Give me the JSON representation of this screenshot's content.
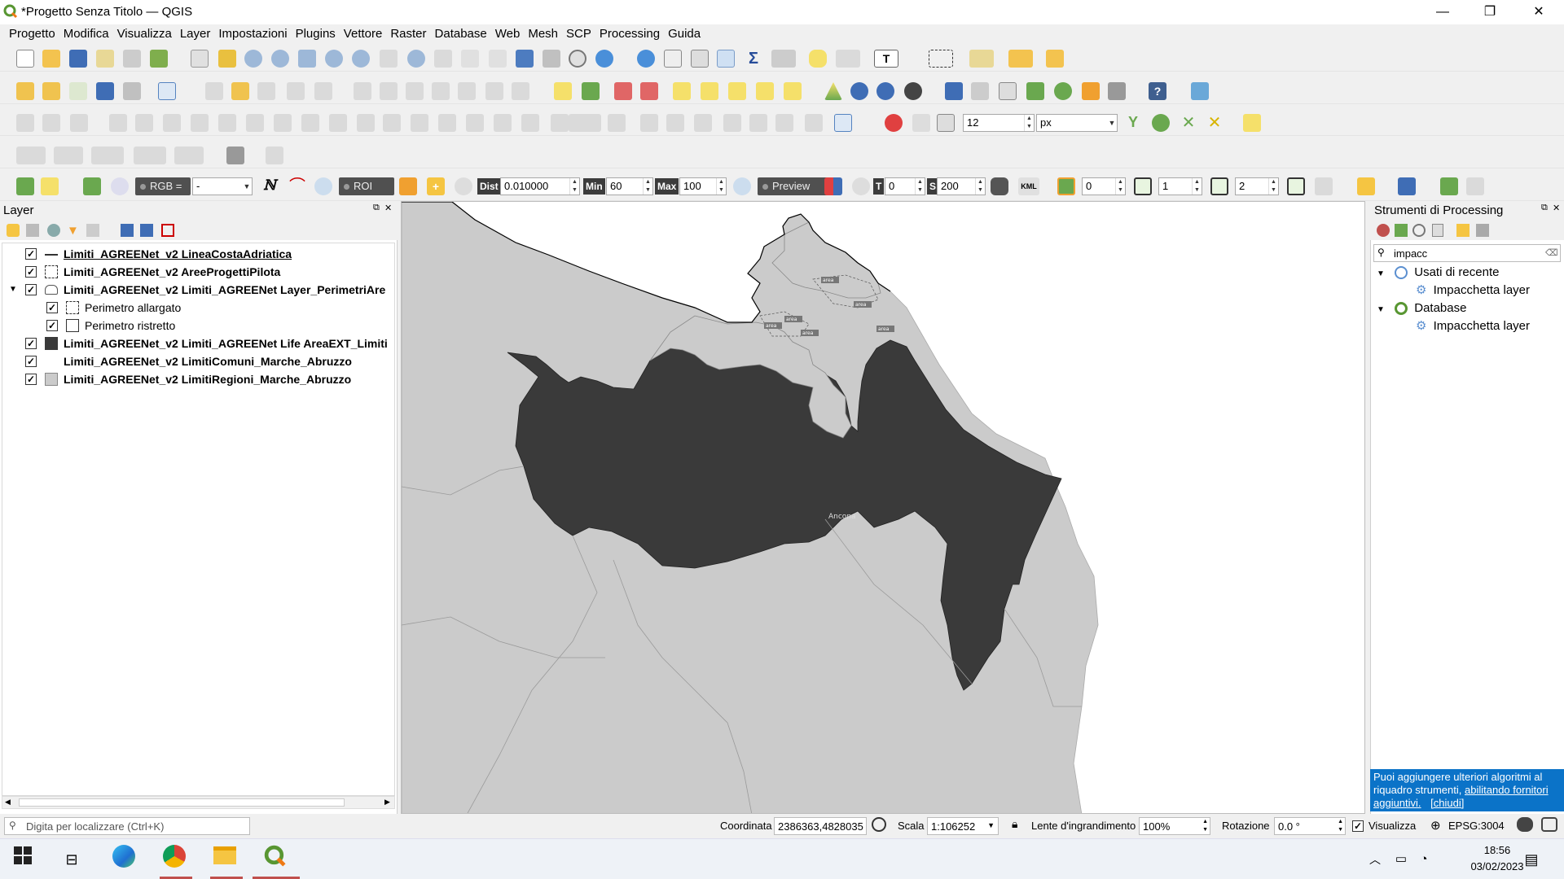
{
  "window": {
    "title": "*Progetto Senza Titolo — QGIS",
    "minimize": "—",
    "maximize": "❐",
    "close": "✕"
  },
  "menu": [
    "Progetto",
    "Modifica",
    "Visualizza",
    "Layer",
    "Impostazioni",
    "Plugins",
    "Vettore",
    "Raster",
    "Database",
    "Web",
    "Mesh",
    "SCP",
    "Processing",
    "Guida"
  ],
  "toolbar": {
    "snap_tolerance": "12",
    "snap_unit": "px",
    "rgb_label": "RGB =",
    "rgb_value": "-",
    "roi_label": "ROI",
    "dist_label": "Dist",
    "dist_value": "0.010000",
    "min_label": "Min",
    "min_value": "60",
    "max_label": "Max",
    "max_value": "100",
    "preview_label": "Preview",
    "t_label": "T",
    "t_value": "0",
    "s_label": "S",
    "s_value": "200",
    "kml_label": "KML",
    "band_value_1": "0",
    "band_value_2": "1",
    "band_value_3": "2"
  },
  "layers_panel": {
    "title": "Layer",
    "layers": [
      {
        "name": "Limiti_AGREENet_v2 LineaCostaAdriatica",
        "checked": true,
        "symbol": "line"
      },
      {
        "name": "Limiti_AGREENet_v2 AreeProgettiPilota",
        "checked": true,
        "symbol": "dashed-box"
      },
      {
        "name": "Limiti_AGREENet_v2 Limiti_AGREENet Layer_PerimetriAre",
        "checked": true,
        "symbol": "polygon-outline"
      },
      {
        "name": "Perimetro allargato",
        "checked": true,
        "symbol": "dashed-box",
        "child": true
      },
      {
        "name": "Perimetro ristretto",
        "checked": true,
        "symbol": "white-box",
        "child": true
      },
      {
        "name": "Limiti_AGREENet_v2 Limiti_AGREENet Life AreaEXT_Limiti",
        "checked": true,
        "symbol": "dark-box"
      },
      {
        "name": "Limiti_AGREENet_v2 LimitiComuni_Marche_Abruzzo",
        "checked": true,
        "symbol": "none"
      },
      {
        "name": "Limiti_AGREENet_v2 LimitiRegioni_Marche_Abruzzo",
        "checked": true,
        "symbol": "light-box"
      }
    ]
  },
  "map": {
    "city_label": "Ancona",
    "area_labels": [
      "area",
      "area",
      "area",
      "area",
      "area",
      "area"
    ],
    "colors": {
      "background": "#ffffff",
      "light_region": "#cbcbcb",
      "dark_area": "#3a3a3a",
      "coast_line": "#000000"
    }
  },
  "processing_panel": {
    "title": "Strumenti di Processing",
    "search_value": "impacc",
    "groups": [
      {
        "label": "Usati di recente",
        "items": [
          "Impacchetta layer"
        ]
      },
      {
        "label": "Database",
        "items": [
          "Impacchetta layer"
        ]
      }
    ],
    "info_text": "Puoi aggiungere ulteriori algoritmi al riquadro strumenti, ",
    "info_link": "abilitando fornitori aggiuntivi.",
    "info_close": "[chiudi]"
  },
  "statusbar": {
    "locator_placeholder": "Digita per localizzare (Ctrl+K)",
    "coord_label": "Coordinata",
    "coord_value": "2386363,4828035",
    "scale_label": "Scala",
    "scale_value": "1:106252",
    "magnifier_label": "Lente d'ingrandimento",
    "magnifier_value": "100%",
    "rotation_label": "Rotazione",
    "rotation_value": "0.0 °",
    "render_label": "Visualizza",
    "crs_label": "EPSG:3004"
  },
  "taskbar": {
    "time": "18:56",
    "date": "03/02/2023"
  }
}
